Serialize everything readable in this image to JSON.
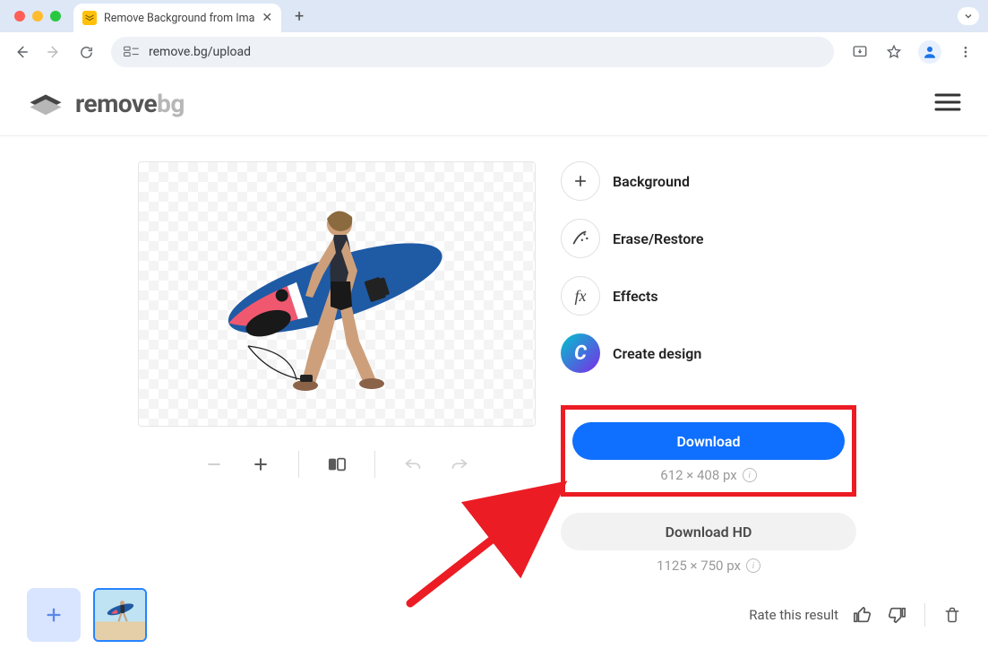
{
  "browser": {
    "tab_title": "Remove Background from Ima",
    "url": "remove.bg/upload"
  },
  "logo": {
    "part1": "remove",
    "part2": "bg"
  },
  "actions": {
    "background": "Background",
    "erase_restore": "Erase/Restore",
    "effects": "Effects",
    "create_design": "Create design"
  },
  "download": {
    "primary_label": "Download",
    "primary_dim": "612 × 408 px",
    "hd_label": "Download HD",
    "hd_dim": "1125 × 750 px"
  },
  "rate_label": "Rate this result",
  "canva_glyph": "C"
}
